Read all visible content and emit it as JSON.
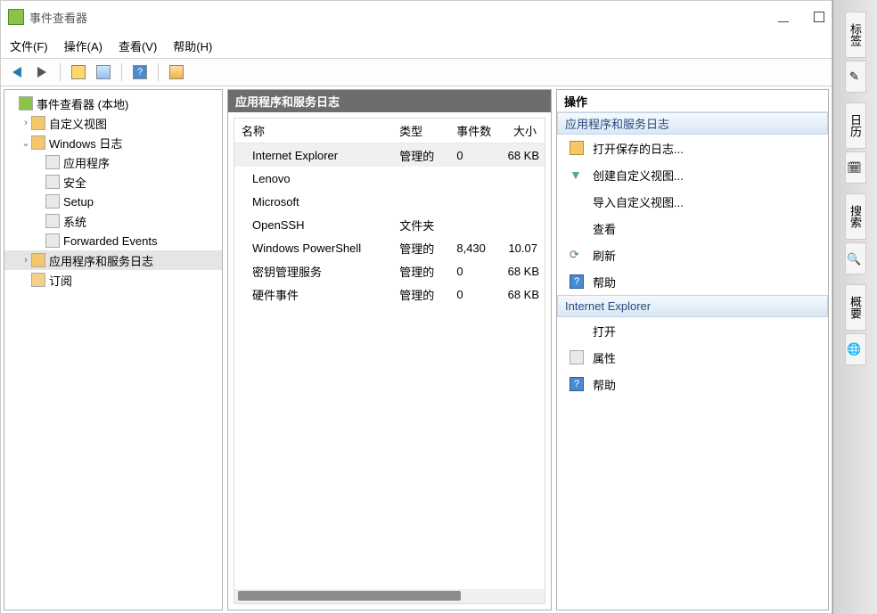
{
  "window": {
    "title": "事件查看器"
  },
  "menu": {
    "file": "文件(F)",
    "action": "操作(A)",
    "view": "查看(V)",
    "help": "帮助(H)"
  },
  "tree": {
    "root": "事件查看器 (本地)",
    "custom_views": "自定义视图",
    "windows_logs": "Windows 日志",
    "app": "应用程序",
    "security": "安全",
    "setup": "Setup",
    "system": "系统",
    "forwarded": "Forwarded Events",
    "app_services_logs": "应用程序和服务日志",
    "subscriptions": "订阅"
  },
  "list": {
    "title": "应用程序和服务日志",
    "columns": {
      "name": "名称",
      "type": "类型",
      "count": "事件数",
      "size": "大小"
    },
    "rows": [
      {
        "name": "Internet Explorer",
        "type": "管理的",
        "count": "0",
        "size": "68 KB",
        "selected": true
      },
      {
        "name": "Lenovo",
        "type": "",
        "count": "",
        "size": ""
      },
      {
        "name": "Microsoft",
        "type": "",
        "count": "",
        "size": ""
      },
      {
        "name": "OpenSSH",
        "type": "文件夹",
        "count": "",
        "size": ""
      },
      {
        "name": "Windows PowerShell",
        "type": "管理的",
        "count": "8,430",
        "size": "10.07"
      },
      {
        "name": "密钥管理服务",
        "type": "管理的",
        "count": "0",
        "size": "68 KB"
      },
      {
        "name": "硬件事件",
        "type": "管理的",
        "count": "0",
        "size": "68 KB"
      }
    ]
  },
  "actions": {
    "title": "操作",
    "section_top": "应用程序和服务日志",
    "open_saved": "打开保存的日志...",
    "create_custom": "创建自定义视图...",
    "import_custom": "导入自定义视图...",
    "view": "查看",
    "refresh": "刷新",
    "help": "帮助",
    "section_sel": "Internet Explorer",
    "open": "打开",
    "properties": "属性",
    "help2": "帮助"
  },
  "side": {
    "tags": "标签",
    "calendar": "日历",
    "search": "搜索",
    "summary": "概要"
  }
}
